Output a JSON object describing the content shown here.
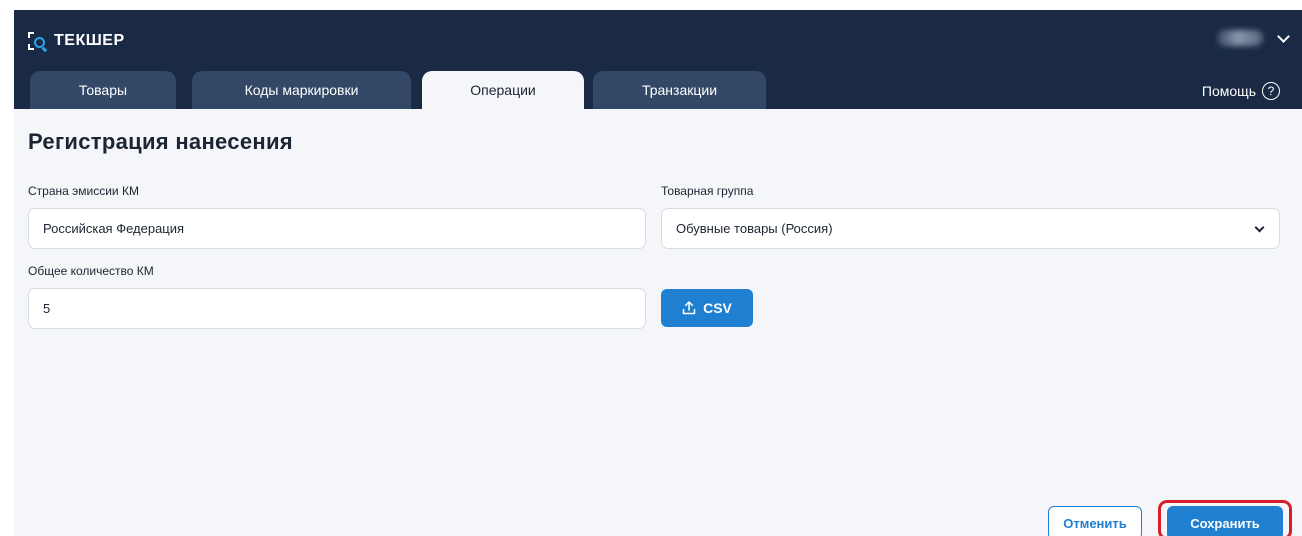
{
  "app": {
    "logo_text": "ТЕКШЕР"
  },
  "header": {
    "user_name": "",
    "help_label": "Помощь",
    "help_icon": "?"
  },
  "tabs": [
    {
      "label": "Товары",
      "active": false
    },
    {
      "label": "Коды маркировки",
      "active": false
    },
    {
      "label": "Операции",
      "active": true
    },
    {
      "label": "Транзакции",
      "active": false
    }
  ],
  "page": {
    "title": "Регистрация нанесения"
  },
  "form": {
    "country": {
      "label": "Страна эмиссии КМ",
      "value": "Российская Федерация"
    },
    "product_group": {
      "label": "Товарная группа",
      "value": "Обувные товары (Россия)"
    },
    "total_count": {
      "label": "Общее количество КМ",
      "value": "5"
    },
    "csv_button": "CSV"
  },
  "footer": {
    "cancel_label": "Отменить",
    "save_label": "Сохранить"
  },
  "colors": {
    "header_bg": "#1a2a44",
    "tab_bg": "#334866",
    "content_bg": "#f4f6f9",
    "primary": "#1f7fd0",
    "highlight": "#d61f2b"
  }
}
